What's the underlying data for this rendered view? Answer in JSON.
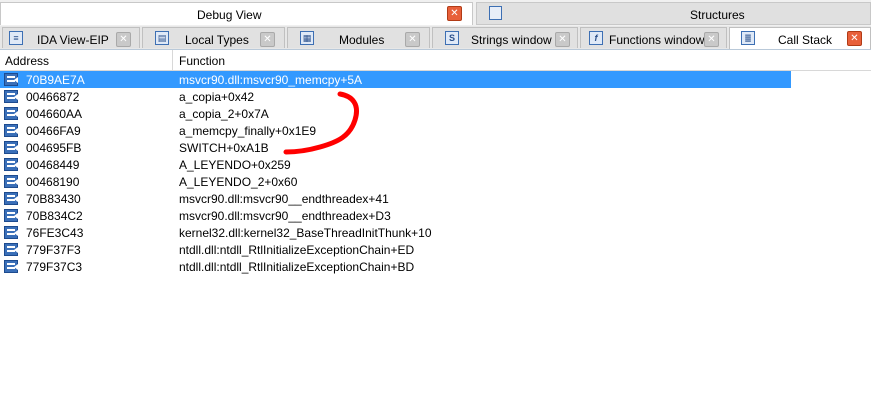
{
  "top_tabs": {
    "active_title": "Debug View",
    "inactive_title": "Structures",
    "close_glyph": "✕"
  },
  "tabs": [
    {
      "label": "IDA View-EIP",
      "icon": "ida-view-icon",
      "icon_glyph": "≡"
    },
    {
      "label": "Local Types",
      "icon": "local-types-icon",
      "icon_glyph": "▤"
    },
    {
      "label": "Modules",
      "icon": "modules-icon",
      "icon_glyph": "▦"
    },
    {
      "label": "Strings window",
      "icon": "strings-icon",
      "icon_glyph": "S"
    },
    {
      "label": "Functions window",
      "icon": "functions-icon",
      "icon_glyph": "f"
    },
    {
      "label": "Call Stack",
      "icon": "call-stack-icon",
      "icon_glyph": "≣"
    }
  ],
  "table": {
    "headers": {
      "address": "Address",
      "function": "Function"
    },
    "rows": [
      {
        "address": "70B9AE7A",
        "function": "msvcr90.dll:msvcr90_memcpy+5A",
        "selected": true
      },
      {
        "address": "00466872",
        "function": "a_copia+0x42"
      },
      {
        "address": "004660AA",
        "function": "a_copia_2+0x7A"
      },
      {
        "address": "00466FA9",
        "function": "a_memcpy_finally+0x1E9"
      },
      {
        "address": "004695FB",
        "function": "SWITCH+0xA1B"
      },
      {
        "address": "00468449",
        "function": "A_LEYENDO+0x259"
      },
      {
        "address": "00468190",
        "function": "A_LEYENDO_2+0x60"
      },
      {
        "address": "70B83430",
        "function": "msvcr90.dll:msvcr90__endthreadex+41"
      },
      {
        "address": "70B834C2",
        "function": "msvcr90.dll:msvcr90__endthreadex+D3"
      },
      {
        "address": "76FE3C43",
        "function": "kernel32.dll:kernel32_BaseThreadInitThunk+10"
      },
      {
        "address": "779F37F3",
        "function": "ntdll.dll:ntdll_RtlInitializeExceptionChain+ED"
      },
      {
        "address": "779F37C3",
        "function": "ntdll.dll:ntdll_RtlInitializeExceptionChain+BD"
      }
    ]
  },
  "colors": {
    "selection": "#3399ff",
    "annotation": "#ff0000"
  }
}
